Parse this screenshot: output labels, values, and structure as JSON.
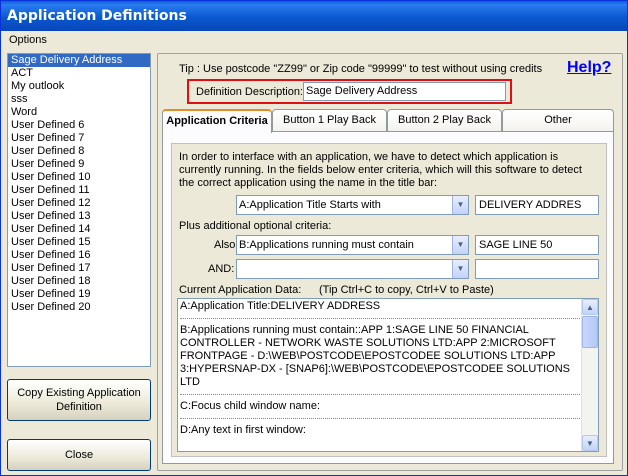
{
  "window": {
    "title": "Application Definitions"
  },
  "menu": {
    "options": "Options"
  },
  "definitions_list": [
    "Sage Delivery Address",
    "ACT",
    "My outlook",
    "sss",
    "Word",
    "User Defined 6",
    "User Defined 7",
    "User Defined 8",
    "User Defined 9",
    "User Defined 10",
    "User Defined 11",
    "User Defined 12",
    "User Defined 13",
    "User Defined 14",
    "User Defined 15",
    "User Defined 16",
    "User Defined 17",
    "User Defined 18",
    "User Defined 19",
    "User Defined 20"
  ],
  "selected_definition": "Sage Delivery Address",
  "buttons": {
    "copy": "Copy Existing Application Definition",
    "close": "Close"
  },
  "tip": "Tip : Use postcode \"ZZ99\" or Zip code \"99999\" to test without using credits",
  "help": "Help?",
  "description": {
    "label": "Definition Description:",
    "value": "Sage Delivery Address"
  },
  "tabs": [
    "Application Criteria",
    "Button 1 Play Back",
    "Button 2 Play Back",
    "Other"
  ],
  "criteria": {
    "intro": "In order to interface with an application, we have to detect which application is currently running.   In the fields below enter criteria, which will this software to detect the correct application using the name in the title bar:",
    "criterion1": {
      "type": "A:Application Title Starts with",
      "value": "DELIVERY ADDRES"
    },
    "optional_label": "Plus additional optional criteria:",
    "also_label": "Also:",
    "criterion2": {
      "type": "B:Applications running must contain",
      "value": "SAGE LINE 50"
    },
    "and_label": "AND:",
    "criterion3": {
      "type": "",
      "value": ""
    },
    "current_label": "Current Application Data:",
    "current_tip": "(Tip Ctrl+C to copy, Ctrl+V to Paste)",
    "data_lines": {
      "a": "A:Application Title:DELIVERY ADDRESS",
      "b": "B:Applications running must contain::APP 1:SAGE LINE 50 FINANCIAL CONTROLLER - NETWORK WASTE SOLUTIONS LTD:APP 2:MICROSOFT FRONTPAGE - D:\\WEB\\POSTCODE\\EPOSTCODEE SOLUTIONS LTD:APP 3:HYPERSNAP-DX - [SNAP6]:\\WEB\\POSTCODE\\EPOSTCODEE SOLUTIONS LTD",
      "c": "C:Focus child window name:",
      "d": "D:Any text in first window:"
    }
  }
}
